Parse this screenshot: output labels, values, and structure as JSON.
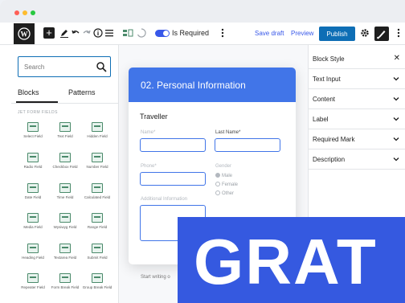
{
  "window": {
    "dots": [
      "#ff5f57",
      "#febc2e",
      "#28c840"
    ]
  },
  "toolbar": {
    "icons": [
      "wordpress-logo",
      "add-block-icon",
      "pencil-icon",
      "undo-icon",
      "redo-icon",
      "info-icon",
      "list-view-icon",
      "jet-form-icon",
      "loading-icon"
    ],
    "toggle_label": "Is Required",
    "toggle_on": true,
    "save_draft": "Save draft",
    "preview": "Preview",
    "publish": "Publish",
    "accent": "#3858e9",
    "publish_color": "#0e6eb5"
  },
  "sidebar": {
    "search_placeholder": "Search",
    "tabs": [
      "Blocks",
      "Patterns"
    ],
    "active_tab": "Blocks",
    "section_title": "JET FORM FIELDS",
    "blocks": [
      "Select Field",
      "Text Field",
      "Hidden Field",
      "Radio Field",
      "Checkbox Field",
      "Number Field",
      "Date Field",
      "Time Field",
      "Calculated Field",
      "Media Field",
      "Wysiwyg Field",
      "Range Field",
      "Heading Field",
      "Textarea Field",
      "Submit Field",
      "Repeater Field",
      "Form Break Field",
      "Group Break Field"
    ]
  },
  "form": {
    "title": "02. Personal Information",
    "header_color": "#4175e8",
    "section": "Traveller",
    "name_label": "Name*",
    "last_name_label": "Last Name*",
    "phone_label": "Phone*",
    "gender_label": "Gender",
    "gender_options": [
      "Male",
      "Female",
      "Other"
    ],
    "gender_selected": "Male",
    "additional_label": "Additional Information",
    "start_writing": "Start writing o"
  },
  "inspector": {
    "header": "Block Style",
    "panels": [
      "Text Input",
      "Content",
      "Label",
      "Required Mark",
      "Description"
    ]
  },
  "banner": {
    "text": "GRAT",
    "color": "#3559e0"
  }
}
